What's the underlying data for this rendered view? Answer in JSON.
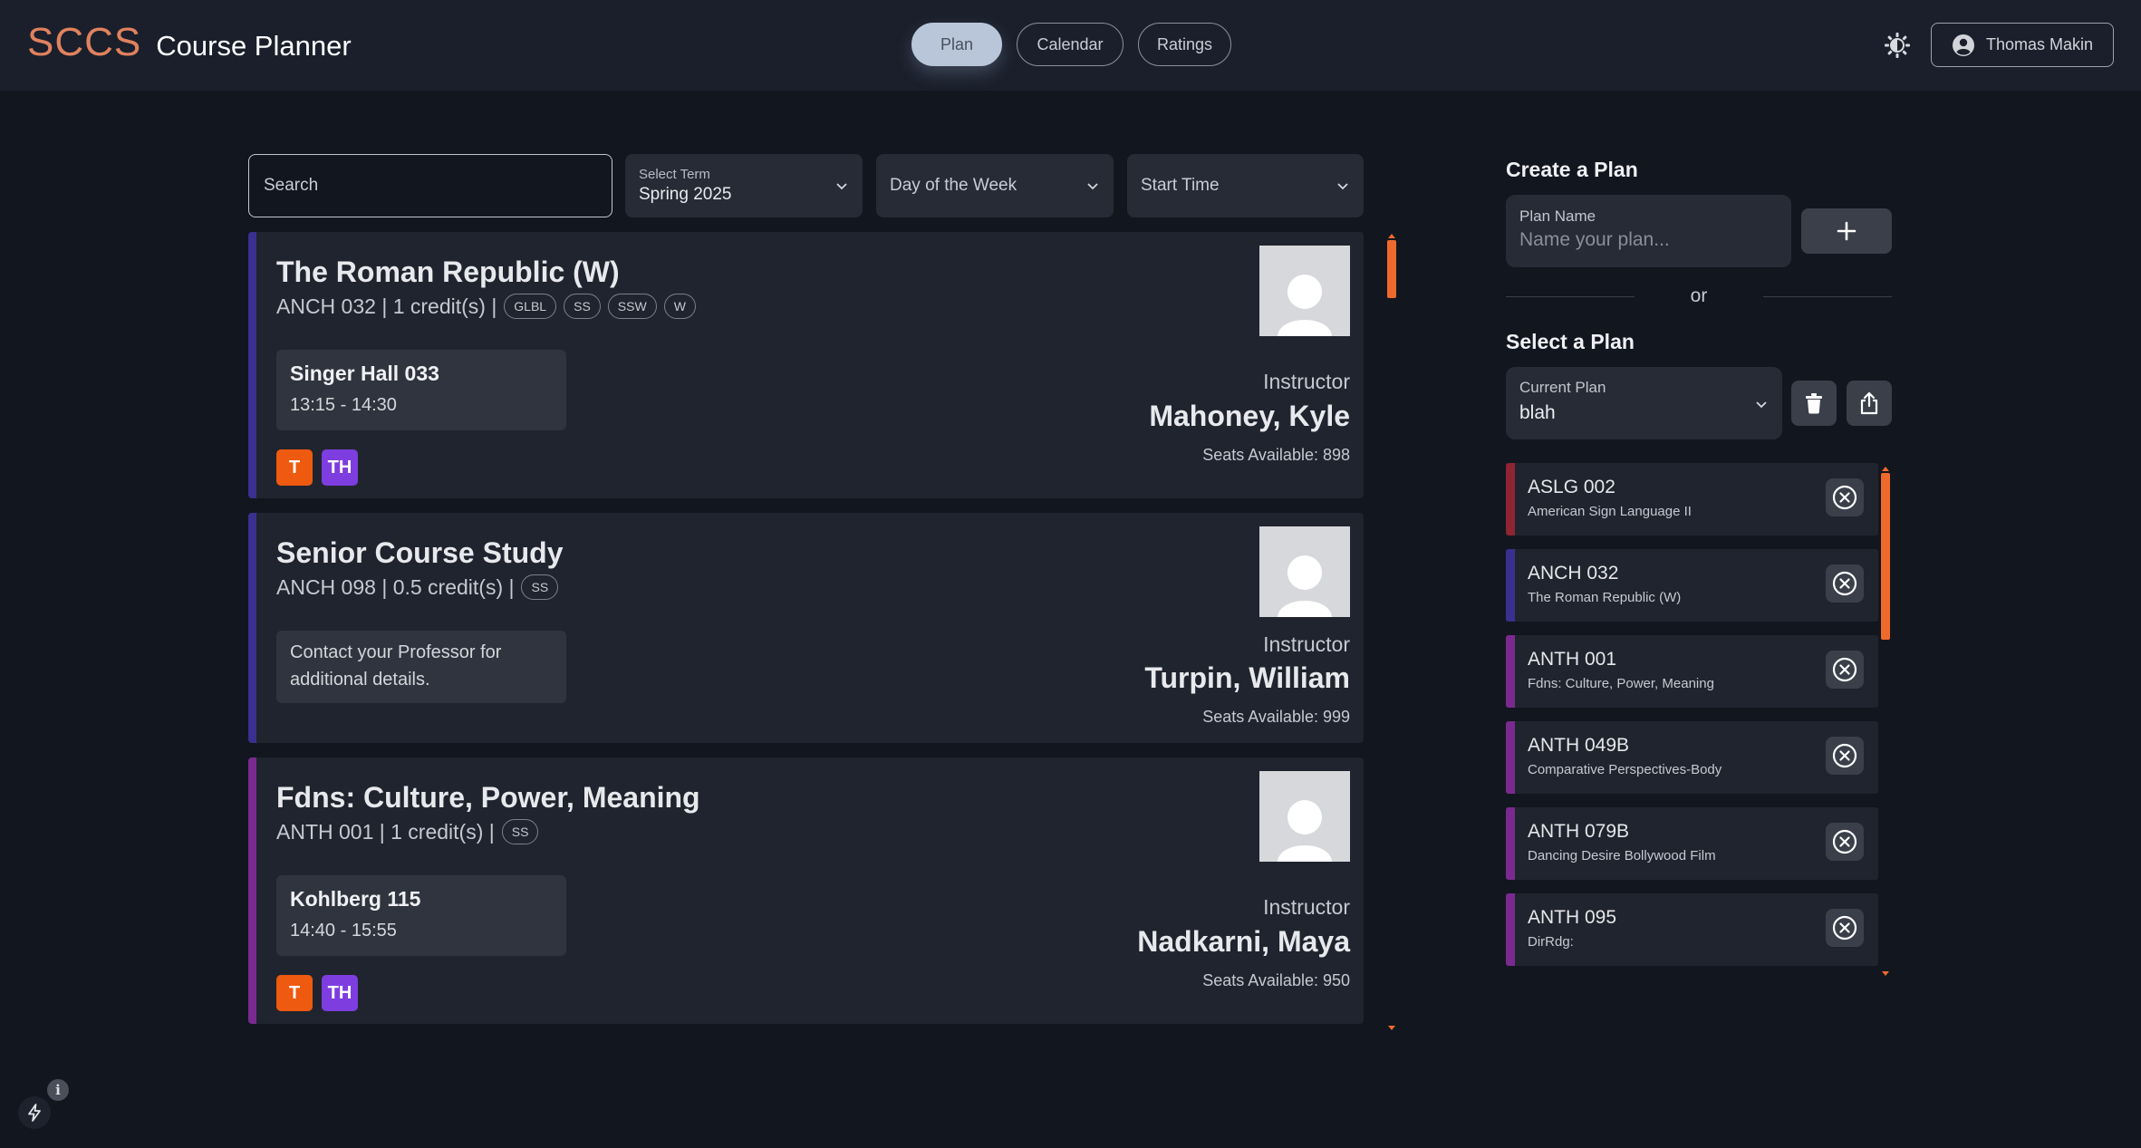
{
  "header": {
    "logo": "SCCS",
    "app_name": "Course Planner",
    "tabs": [
      {
        "label": "Plan",
        "active": true
      },
      {
        "label": "Calendar",
        "active": false
      },
      {
        "label": "Ratings",
        "active": false
      }
    ],
    "theme_icon": "sun-icon",
    "user_name": "Thomas Makin"
  },
  "filters": {
    "search_placeholder": "Search",
    "term_label": "Select Term",
    "term_value": "Spring 2025",
    "day_placeholder": "Day of the Week",
    "time_placeholder": "Start Time"
  },
  "courses": [
    {
      "title": "The Roman Republic (W)",
      "meta": "ANCH 032 | 1 credit(s) |",
      "tags": [
        "GLBL",
        "SS",
        "SSW",
        "W"
      ],
      "room": "Singer Hall 033",
      "time": "13:15 - 14:30",
      "days": [
        "T",
        "TH"
      ],
      "instructor_label": "Instructor",
      "instructor": "Mahoney, Kyle",
      "seats": "Seats Available: 898",
      "color": "#3b2f8f"
    },
    {
      "title": "Senior Course Study",
      "meta": "ANCH 098 | 0.5 credit(s) |",
      "tags": [
        "SS"
      ],
      "note": "Contact your Professor for additional details.",
      "instructor_label": "Instructor",
      "instructor": "Turpin, William",
      "seats": "Seats Available: 999",
      "color": "#3b2f8f"
    },
    {
      "title": "Fdns: Culture, Power, Meaning",
      "meta": "ANTH 001 | 1 credit(s) |",
      "tags": [
        "SS"
      ],
      "room": "Kohlberg 115",
      "time": "14:40 - 15:55",
      "days": [
        "T",
        "TH"
      ],
      "instructor_label": "Instructor",
      "instructor": "Nadkarni, Maya",
      "seats": "Seats Available: 950",
      "color": "#7a2a8f"
    }
  ],
  "day_colors": {
    "T": "#ee5a0f",
    "TH": "#7d3ddf"
  },
  "sidebar": {
    "create_heading": "Create a Plan",
    "plan_name_label": "Plan Name",
    "plan_name_placeholder": "Name your plan...",
    "add_icon": "plus-icon",
    "or_text": "or",
    "select_heading": "Select a Plan",
    "current_plan_label": "Current Plan",
    "current_plan_value": "blah",
    "delete_icon": "trash-icon",
    "share_icon": "share-icon",
    "plan_courses": [
      {
        "code": "ASLG 002",
        "name": "American Sign Language II",
        "color": "#8f2432"
      },
      {
        "code": "ANCH 032",
        "name": "The Roman Republic (W)",
        "color": "#3b2f8f"
      },
      {
        "code": "ANTH 001",
        "name": "Fdns: Culture, Power, Meaning",
        "color": "#7a2a8f"
      },
      {
        "code": "ANTH 049B",
        "name": "Comparative Perspectives-Body",
        "color": "#7a2a8f"
      },
      {
        "code": "ANTH 079B",
        "name": "Dancing Desire Bollywood Film",
        "color": "#7a2a8f"
      },
      {
        "code": "ANTH 095",
        "name": "DirRdg:",
        "color": "#7a2a8f"
      }
    ]
  },
  "accent": "#ee6a2c"
}
